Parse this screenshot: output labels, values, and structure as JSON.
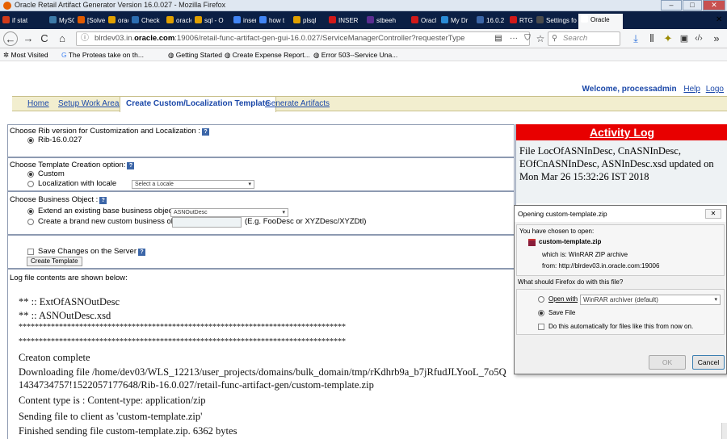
{
  "window": {
    "title": "Oracle Retail Artifact Generator Version 16.0.027 - Mozilla Firefox",
    "controls": [
      "–",
      "□",
      "✕"
    ]
  },
  "tabs": [
    {
      "label": "if stat",
      "color": "#d13a1a"
    },
    {
      "label": "MySQ",
      "color": "#3d7aa8"
    },
    {
      "label": "[Solve",
      "color": "#e05a00"
    },
    {
      "label": "oracle",
      "color": "#e0a000"
    },
    {
      "label": "Check",
      "color": "#2c6db0"
    },
    {
      "label": "oracle",
      "color": "#e0a000"
    },
    {
      "label": "sql - O",
      "color": "#e0a000"
    },
    {
      "label": "insert",
      "color": "#4285f4"
    },
    {
      "label": "how t",
      "color": "#4285f4"
    },
    {
      "label": "plsql",
      "color": "#e0a000"
    },
    {
      "label": "INSER",
      "color": "#d11919"
    },
    {
      "label": "stbeeh",
      "color": "#5c2d91"
    },
    {
      "label": "Oracl",
      "color": "#d11919"
    },
    {
      "label": "My Dr",
      "color": "#2a8bd6"
    },
    {
      "label": "16.0.2",
      "color": "#3c66a8"
    },
    {
      "label": "RTG 1(",
      "color": "#d11919"
    },
    {
      "label": "Settings fo",
      "color": "#4b4b4b"
    },
    {
      "label": "Oracle",
      "color": "#ffffff"
    }
  ],
  "nav": {
    "back": "←",
    "forward": "→",
    "reload": "C",
    "home": "⌂",
    "url_prefix": "blrdev03.in.",
    "url_domain": "oracle.com",
    "url_rest": ":19006/retail-func-artifact-gen-gui-16.0.027/ServiceManagerController?requesterType",
    "more": "···",
    "search_placeholder": "Search"
  },
  "bookmarks": [
    "Most Visited",
    "The Proteas take on th...",
    "Getting Started",
    "Create Expense Report...",
    "Error 503--Service Una..."
  ],
  "app": {
    "welcome": "Welcome, processadmin",
    "help": "Help",
    "logout": "Logo",
    "menu": {
      "home": "Home",
      "setup": "Setup Work Areas",
      "create": "Create Custom/Localization Template",
      "generate": "Generate Artifacts"
    }
  },
  "form": {
    "rib_label": "Choose Rib version for Customization and Localization :",
    "rib_option": "Rib-16.0.027",
    "template_label": "Choose Template Creation option:",
    "custom_option": "Custom",
    "locale_option": "Localization with locale",
    "locale_select": "Select a Locale",
    "bo_label": "Choose Business Object :",
    "extend_option": "Extend an existing base business object :",
    "extend_value": "ASNOutDesc",
    "new_option": "Create a brand new custom business object :",
    "new_hint": "(E.g. FooDesc or XYZDesc/XYZDtl)",
    "save_label": "Save Changes on the Server",
    "create_button": "Create Template",
    "log_label": "Log file contents are shown below:"
  },
  "log": [
    "** :: ExtOfASNOutDesc",
    "** :: ASNOutDesc.xsd",
    "*********************************************************************************",
    "*********************************************************************************",
    "Creaton complete",
    "Downloading file /home/dev03/WLS_12213/user_projects/domains/bulk_domain/tmp/rKdhrb9a_b7jRfudJLYooL_7o5Q",
    "1434734757!1522057177648/Rib-16.0.027/retail-func-artifact-gen/custom-template.zip",
    "Content type is : Content-type: application/zip",
    "Sending file to client as 'custom-template.zip'",
    "Finished sending file custom-template.zip. 6362 bytes"
  ],
  "activity": {
    "title": "Activity Log",
    "message": "File LocOfASNInDesc, CnASNInDesc, EOfCnASNInDesc, ASNInDesc.xsd updated on Mon Mar 26 15:32:26 IST 2018"
  },
  "dialog": {
    "title": "Opening custom-template.zip",
    "close": "✕",
    "chosen": "You have chosen to open:",
    "filename": "custom-template.zip",
    "which_is": "which is: WinRAR ZIP archive",
    "from": "from: http://blrdev03.in.oracle.com:19006",
    "question": "What should Firefox do with this file?",
    "open_with": "Open with",
    "open_app": "WinRAR archiver (default)",
    "save_file": "Save File",
    "auto": "Do this automatically for files like this from now on.",
    "ok": "OK",
    "cancel": "Cancel"
  }
}
